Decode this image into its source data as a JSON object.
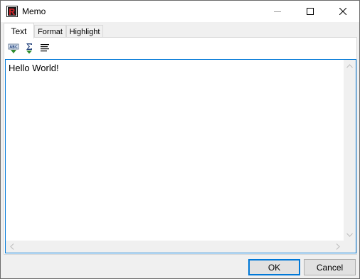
{
  "window": {
    "title": "Memo"
  },
  "tabs": [
    {
      "label": "Text",
      "active": true
    },
    {
      "label": "Format",
      "active": false
    },
    {
      "label": "Highlight",
      "active": false
    }
  ],
  "toolbar": {
    "icons": [
      "abc-spellcheck-icon",
      "sum-icon",
      "align-icon"
    ]
  },
  "editor": {
    "content": "Hello World!"
  },
  "buttons": {
    "ok_label": "OK",
    "cancel_label": "Cancel"
  },
  "colors": {
    "accent": "#0078d7",
    "brand_icon": "#c8102e"
  }
}
